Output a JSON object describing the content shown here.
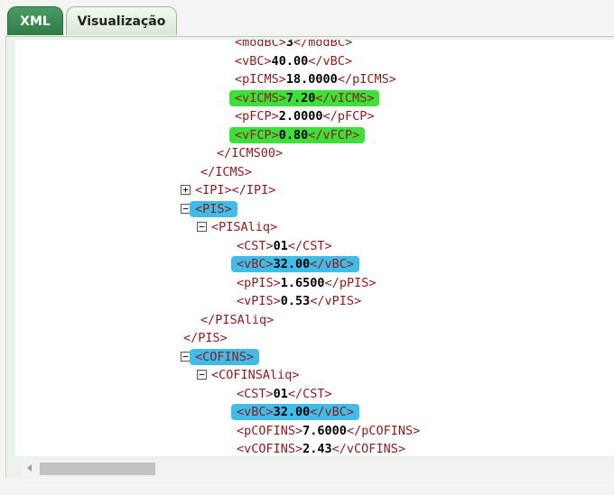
{
  "tabs": [
    {
      "label": "XML",
      "active": true
    },
    {
      "label": "Visualização",
      "active": false
    }
  ],
  "highlight_colors": {
    "green": "#3de03a",
    "blue": "#3fbde8"
  },
  "xml_lines": [
    {
      "indent": 3,
      "open": "<modBC>",
      "value": "3",
      "close": "</modBC>"
    },
    {
      "indent": 3,
      "open": "<vBC>",
      "value": "40.00",
      "close": "</vBC>"
    },
    {
      "indent": 3,
      "open": "<pICMS>",
      "value": "18.0000",
      "close": "</pICMS>"
    },
    {
      "indent": 3,
      "open": "<vICMS>",
      "value": "7.20",
      "close": "</vICMS>",
      "highlight": "green"
    },
    {
      "indent": 3,
      "open": "<pFCP>",
      "value": "2.0000",
      "close": "</pFCP>"
    },
    {
      "indent": 3,
      "open": "<vFCP>",
      "value": "0.80",
      "close": "</vFCP>",
      "highlight": "green"
    },
    {
      "indent": 2,
      "open": "</ICMS00>"
    },
    {
      "indent": 1,
      "open": "</ICMS>"
    },
    {
      "indent": 0,
      "toggle": "+",
      "open": "<IPI></IPI>"
    },
    {
      "indent": 0,
      "toggle": "−",
      "open": "<PIS>",
      "highlight": "blue"
    },
    {
      "indent": 1,
      "toggle": "−",
      "open": "<PISAliq>"
    },
    {
      "indent": 2,
      "open": "<CST>",
      "value": "01",
      "close": "</CST>"
    },
    {
      "indent": 2,
      "open": "<vBC>",
      "value": "32.00",
      "close": "</vBC>",
      "highlight": "blue"
    },
    {
      "indent": 2,
      "open": "<pPIS>",
      "value": "1.6500",
      "close": "</pPIS>"
    },
    {
      "indent": 2,
      "open": "<vPIS>",
      "value": "0.53",
      "close": "</vPIS>"
    },
    {
      "indent": 1,
      "open": "</PISAliq>"
    },
    {
      "indent": 0,
      "open": "</PIS>"
    },
    {
      "indent": 0,
      "toggle": "−",
      "open": "<COFINS>",
      "highlight": "blue"
    },
    {
      "indent": 1,
      "toggle": "−",
      "open": "<COFINSAliq>"
    },
    {
      "indent": 2,
      "open": "<CST>",
      "value": "01",
      "close": "</CST>"
    },
    {
      "indent": 2,
      "open": "<vBC>",
      "value": "32.00",
      "close": "</vBC>",
      "highlight": "blue"
    },
    {
      "indent": 2,
      "open": "<pCOFINS>",
      "value": "7.6000",
      "close": "</pCOFINS>"
    },
    {
      "indent": 2,
      "open": "<vCOFINS>",
      "value": "2.43",
      "close": "</vCOFINS>"
    }
  ]
}
